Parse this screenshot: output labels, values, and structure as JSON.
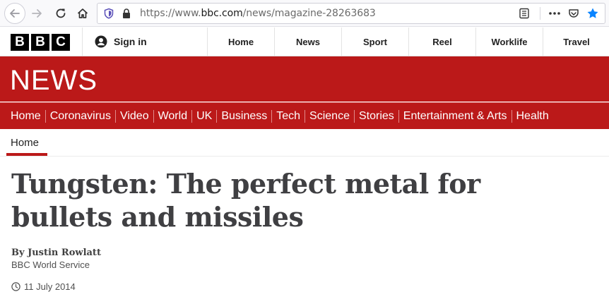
{
  "browser": {
    "url_prefix": "https://www.",
    "url_domain": "bbc.com",
    "url_path": "/news/magazine-28263683"
  },
  "bbc_header": {
    "logo_letters": [
      "B",
      "B",
      "C"
    ],
    "sign_in": "Sign in",
    "nav": [
      "Home",
      "News",
      "Sport",
      "Reel",
      "Worklife",
      "Travel"
    ]
  },
  "news": {
    "title": "NEWS",
    "sections": [
      "Home",
      "Coronavirus",
      "Video",
      "World",
      "UK",
      "Business",
      "Tech",
      "Science",
      "Stories",
      "Entertainment & Arts",
      "Health"
    ]
  },
  "sub_nav": {
    "home": "Home"
  },
  "article": {
    "headline_line1": "Tungsten: The perfect metal for",
    "headline_line2": "bullets and missiles",
    "author": "By Justin Rowlatt",
    "role": "BBC World Service",
    "date": "11 July 2014"
  },
  "colors": {
    "brand_red": "#bb1919"
  }
}
